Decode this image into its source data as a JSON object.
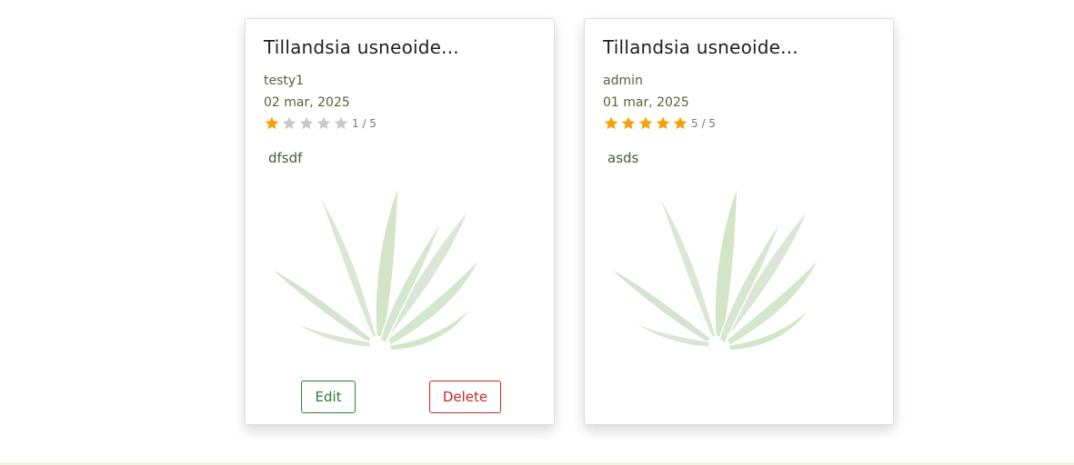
{
  "colors": {
    "star_filled": "#f5a20a",
    "star_empty": "#c9c9c9",
    "edit": "#2e7d32",
    "delete": "#c62828"
  },
  "reviews": [
    {
      "title": "Tillandsia usneoide...",
      "author": "testy1",
      "date": "02 mar, 2025",
      "rating": 1,
      "rating_text": "1 / 5",
      "comment": "dfsdf",
      "image_icon": "plant-image",
      "edit_label": "Edit",
      "delete_label": "Delete"
    },
    {
      "title": "Tillandsia usneoide...",
      "author": "admin",
      "date": "01 mar, 2025",
      "rating": 5,
      "rating_text": "5 / 5",
      "comment": "asds",
      "image_icon": "plant-image"
    }
  ]
}
